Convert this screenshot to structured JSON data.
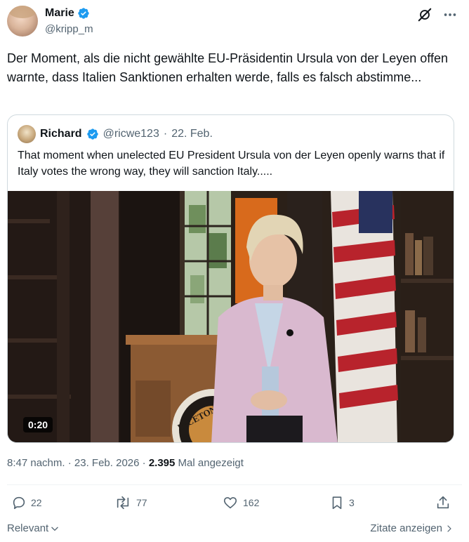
{
  "author": {
    "display_name": "Marie",
    "handle": "@kripp_m"
  },
  "tweet": {
    "text": "Der Moment, als die nicht gewählte EU-Präsidentin Ursula von der Leyen offen warnte, dass Italien Sanktionen erhalten werde, falls es falsch abstimme...",
    "time": "8:47 nachm.",
    "separator": "·",
    "date": "23. Feb. 2026",
    "views": "2.395",
    "views_label": "Mal angezeigt"
  },
  "quoted": {
    "display_name": "Richard",
    "handle": "@ricwe123",
    "date": "22. Feb.",
    "separator": "·",
    "text": "That moment when unelected EU President Ursula von der Leyen openly warns that if Italy votes the wrong way, they will sanction Italy.....",
    "video_duration": "0:20",
    "podium_text": "INCETON U"
  },
  "actions": {
    "replies": "22",
    "reposts": "77",
    "likes": "162",
    "bookmarks": "3"
  },
  "footer": {
    "sort_label": "Relevant",
    "quotes_label": "Zitate anzeigen"
  },
  "colors": {
    "verified": "#1d9bf0",
    "text_primary": "#0f1419",
    "text_secondary": "#536471",
    "border": "#cfd9de"
  },
  "icons": [
    "verified-badge-icon",
    "grok-icon",
    "more-icon",
    "reply-icon",
    "repost-icon",
    "like-icon",
    "bookmark-icon",
    "share-icon",
    "chevron-down-icon",
    "chevron-right-icon"
  ]
}
